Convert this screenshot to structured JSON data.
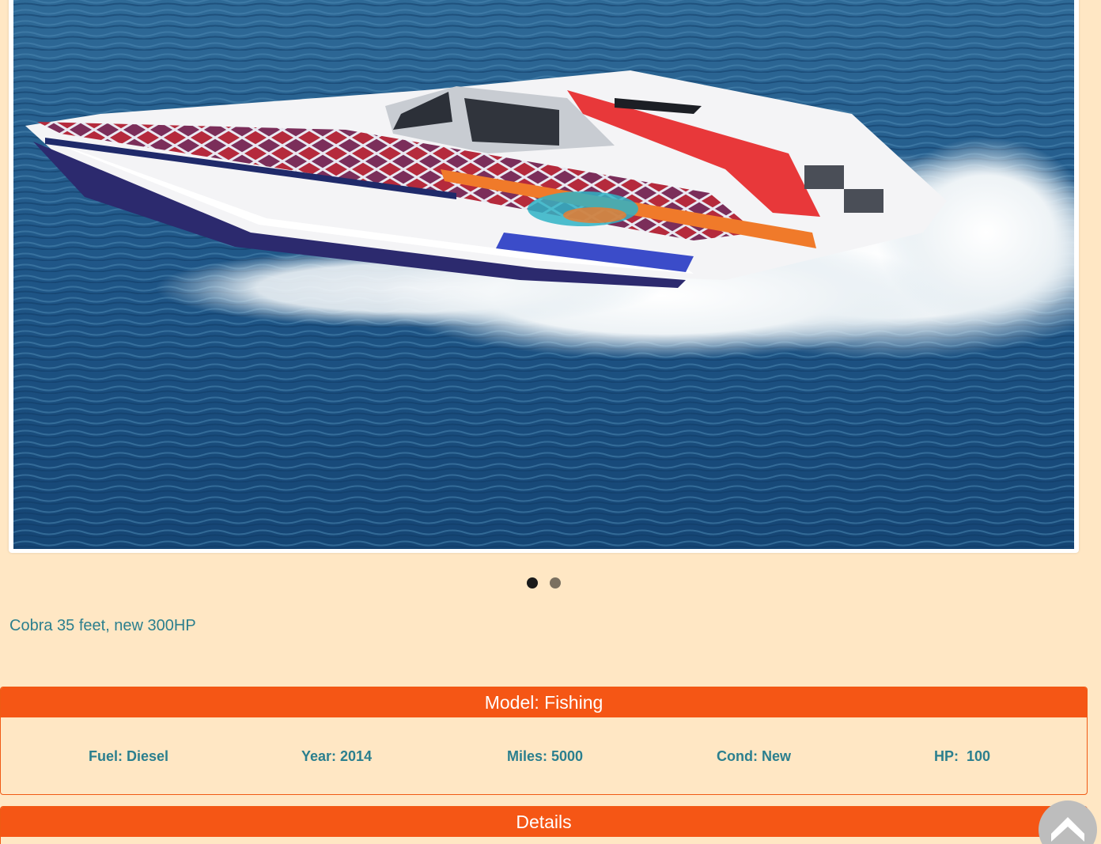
{
  "carousel": {
    "image_subject": "white offshore powerboat with red, blue and orange graphics speeding on open water",
    "dots": [
      {
        "active": true
      },
      {
        "active": false
      }
    ]
  },
  "caption": "Cobra 35 feet, new 300HP",
  "model_panel": {
    "title": "Model: Fishing",
    "specs": {
      "fuel": "Fuel: Diesel",
      "year": "Year: 2014",
      "miles": "Miles: 5000",
      "cond": "Cond: New",
      "hp": "HP:  100"
    }
  },
  "details_panel": {
    "title": "Details"
  },
  "scroll_top": {
    "icon": "chevron-up-icon"
  },
  "colors": {
    "background": "#ffe7c4",
    "accent": "#f55615",
    "text": "#2b7f8e"
  }
}
